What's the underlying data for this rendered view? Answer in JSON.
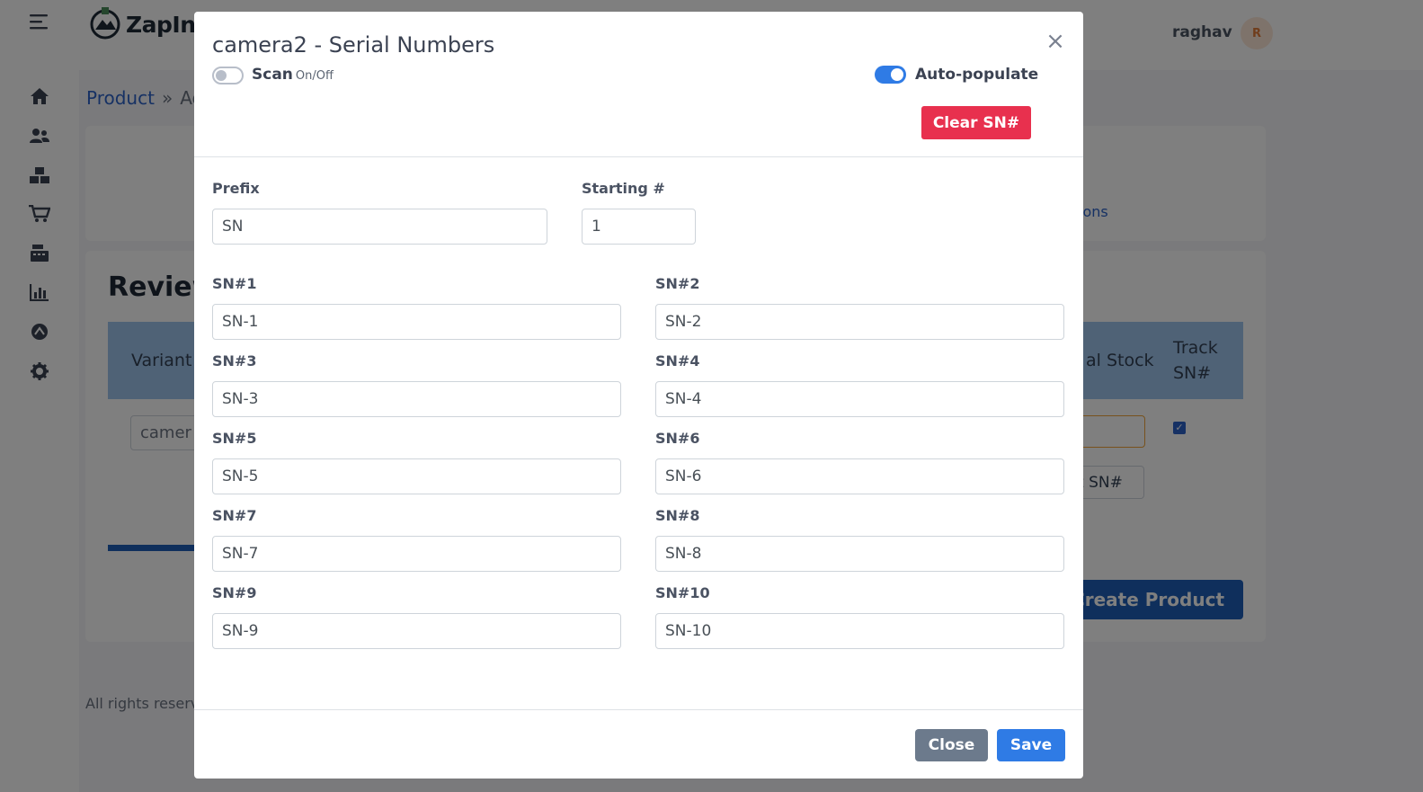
{
  "app": {
    "logo_text": "ZapInv",
    "user_name": "raghav",
    "avatar_initial": "R"
  },
  "breadcrumb": {
    "parent": "Product",
    "separator": "»",
    "current": "Ad"
  },
  "page": {
    "card1_link": "ions",
    "review_title": "Review",
    "table_headers": {
      "variant": "Variant",
      "initial_stock": "al Stock",
      "track_sn_line1": "Track",
      "track_sn_line2": "SN#"
    },
    "variant_value": "camer",
    "set_sn_button": "t SN#",
    "create_button": "Create Product",
    "footer": "All rights reserv"
  },
  "modal": {
    "title": "camera2 - Serial Numbers",
    "scan": {
      "label": "Scan",
      "sub": "On/Off",
      "enabled": false
    },
    "auto_populate": {
      "label": "Auto-populate",
      "enabled": true
    },
    "clear_button": "Clear SN#",
    "prefix": {
      "label": "Prefix",
      "value": "SN"
    },
    "starting": {
      "label": "Starting #",
      "value": "1"
    },
    "serials": [
      {
        "label": "SN#1",
        "value": "SN-1"
      },
      {
        "label": "SN#2",
        "value": "SN-2"
      },
      {
        "label": "SN#3",
        "value": "SN-3"
      },
      {
        "label": "SN#4",
        "value": "SN-4"
      },
      {
        "label": "SN#5",
        "value": "SN-5"
      },
      {
        "label": "SN#6",
        "value": "SN-6"
      },
      {
        "label": "SN#7",
        "value": "SN-7"
      },
      {
        "label": "SN#8",
        "value": "SN-8"
      },
      {
        "label": "SN#9",
        "value": "SN-9"
      },
      {
        "label": "SN#10",
        "value": "SN-10"
      }
    ],
    "close_button": "Close",
    "save_button": "Save"
  }
}
